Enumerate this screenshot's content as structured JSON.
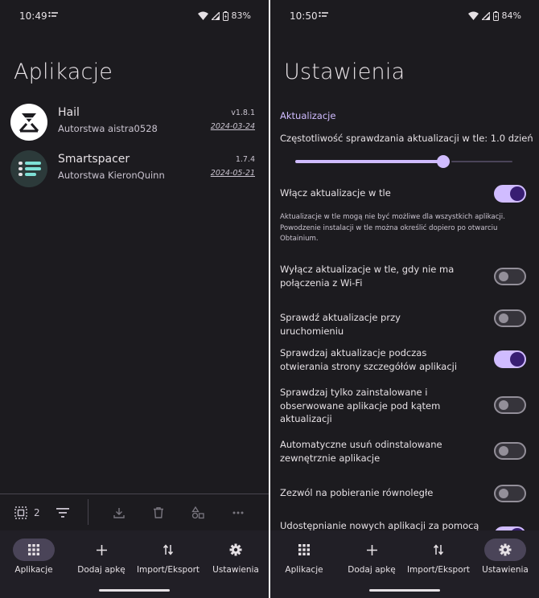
{
  "left": {
    "status": {
      "time": "10:49",
      "battery": "83%"
    },
    "title": "Aplikacje",
    "apps": [
      {
        "name": "Hail",
        "author": "Autorstwa aistra0528",
        "version": "v1.8.1",
        "date": "2024-03-24"
      },
      {
        "name": "Smartspacer",
        "author": "Autorstwa KieronQuinn",
        "version": "1.7.4",
        "date": "2024-05-21"
      }
    ],
    "action_bar": {
      "selected_count": "2"
    },
    "nav": [
      {
        "label": "Aplikacje",
        "icon": "apps-grid-icon",
        "active": true
      },
      {
        "label": "Dodaj apkę",
        "icon": "plus-icon",
        "active": false
      },
      {
        "label": "Import/Eksport",
        "icon": "swap-vert-icon",
        "active": false
      },
      {
        "label": "Ustawienia",
        "icon": "gear-icon",
        "active": false
      }
    ]
  },
  "right": {
    "status": {
      "time": "10:50",
      "battery": "84%"
    },
    "title": "Ustawienia",
    "section": "Aktualizacje",
    "slider": {
      "label": "Częstotliwość sprawdzania aktualizacji w tle: 1.0 dzień",
      "value_fraction": 0.68
    },
    "settings": [
      {
        "label": "Włącz aktualizacje w tle",
        "on": true
      },
      {
        "label": "Wyłącz aktualizacje w tle, gdy nie ma połączenia z Wi-Fi",
        "on": false
      },
      {
        "label": "Sprawdź aktualizacje przy uruchomieniu",
        "on": false
      },
      {
        "label": "Sprawdzaj aktualizacje podczas otwierania strony szczegółów aplikacji",
        "on": true
      },
      {
        "label": "Sprawdzaj tylko zainstalowane i obserwowane aplikacje pod kątem aktualizacji",
        "on": false
      },
      {
        "label": "Automatyczne usuń odinstalowane zewnętrznie aplikacje",
        "on": false
      },
      {
        "label": "Zezwól na pobieranie równoległe",
        "on": false
      },
      {
        "label": "Udostępnianie nowych aplikacji za pomocą",
        "on": true
      }
    ],
    "note": "Aktualizacje w tle mogą nie być możliwe dla wszystkich aplikacji. Powodzenie instalacji w tle można określić dopiero po otwarciu Obtainium.",
    "nav": [
      {
        "label": "Aplikacje",
        "icon": "apps-grid-icon",
        "active": false
      },
      {
        "label": "Dodaj apkę",
        "icon": "plus-icon",
        "active": false
      },
      {
        "label": "Import/Eksport",
        "icon": "swap-vert-icon",
        "active": false
      },
      {
        "label": "Ustawienia",
        "icon": "gear-icon",
        "active": true
      }
    ]
  },
  "colors": {
    "background": "#1c1b1f",
    "accent": "#d0bcff",
    "nav_bg": "#211f26",
    "active_pill": "#4a4458"
  }
}
